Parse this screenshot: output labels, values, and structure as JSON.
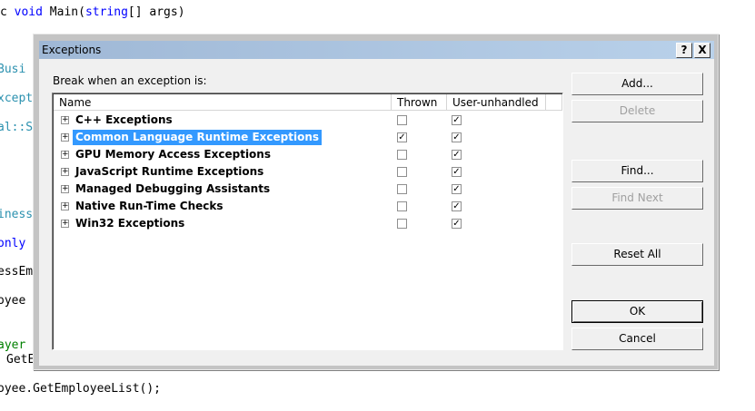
{
  "code_lines": [
    {
      "t": "c void Main(string[] args)"
    },
    {
      "t": "Busi"
    },
    {
      "t": "xcept"
    },
    {
      "t": "al::S"
    },
    {
      "t": "iness"
    },
    {
      "t": "only"
    },
    {
      "t": "essEm"
    },
    {
      "t": "oyee"
    },
    {
      "t": "ayer"
    },
    {
      "t": "GetE"
    },
    {
      "t": "oyee.GetEmployeeList();"
    }
  ],
  "dialog": {
    "title": "Exceptions",
    "help": "?",
    "close": "X",
    "label": "Break when an exception is:",
    "columns": [
      "Name",
      "Thrown",
      "User-unhandled"
    ],
    "rows": [
      {
        "name": "C++ Exceptions",
        "thrown": false,
        "unhandled": true
      },
      {
        "name": "Common Language Runtime Exceptions",
        "thrown": true,
        "unhandled": true,
        "selected": true
      },
      {
        "name": "GPU Memory Access Exceptions",
        "thrown": false,
        "unhandled": true
      },
      {
        "name": "JavaScript Runtime Exceptions",
        "thrown": false,
        "unhandled": true
      },
      {
        "name": "Managed Debugging Assistants",
        "thrown": false,
        "unhandled": true
      },
      {
        "name": "Native Run-Time Checks",
        "thrown": false,
        "unhandled": true
      },
      {
        "name": "Win32 Exceptions",
        "thrown": false,
        "unhandled": true
      }
    ],
    "buttons": {
      "add": "Add...",
      "delete": "Delete",
      "find": "Find...",
      "find_next": "Find Next",
      "reset_all": "Reset All",
      "ok": "OK",
      "cancel": "Cancel"
    }
  }
}
